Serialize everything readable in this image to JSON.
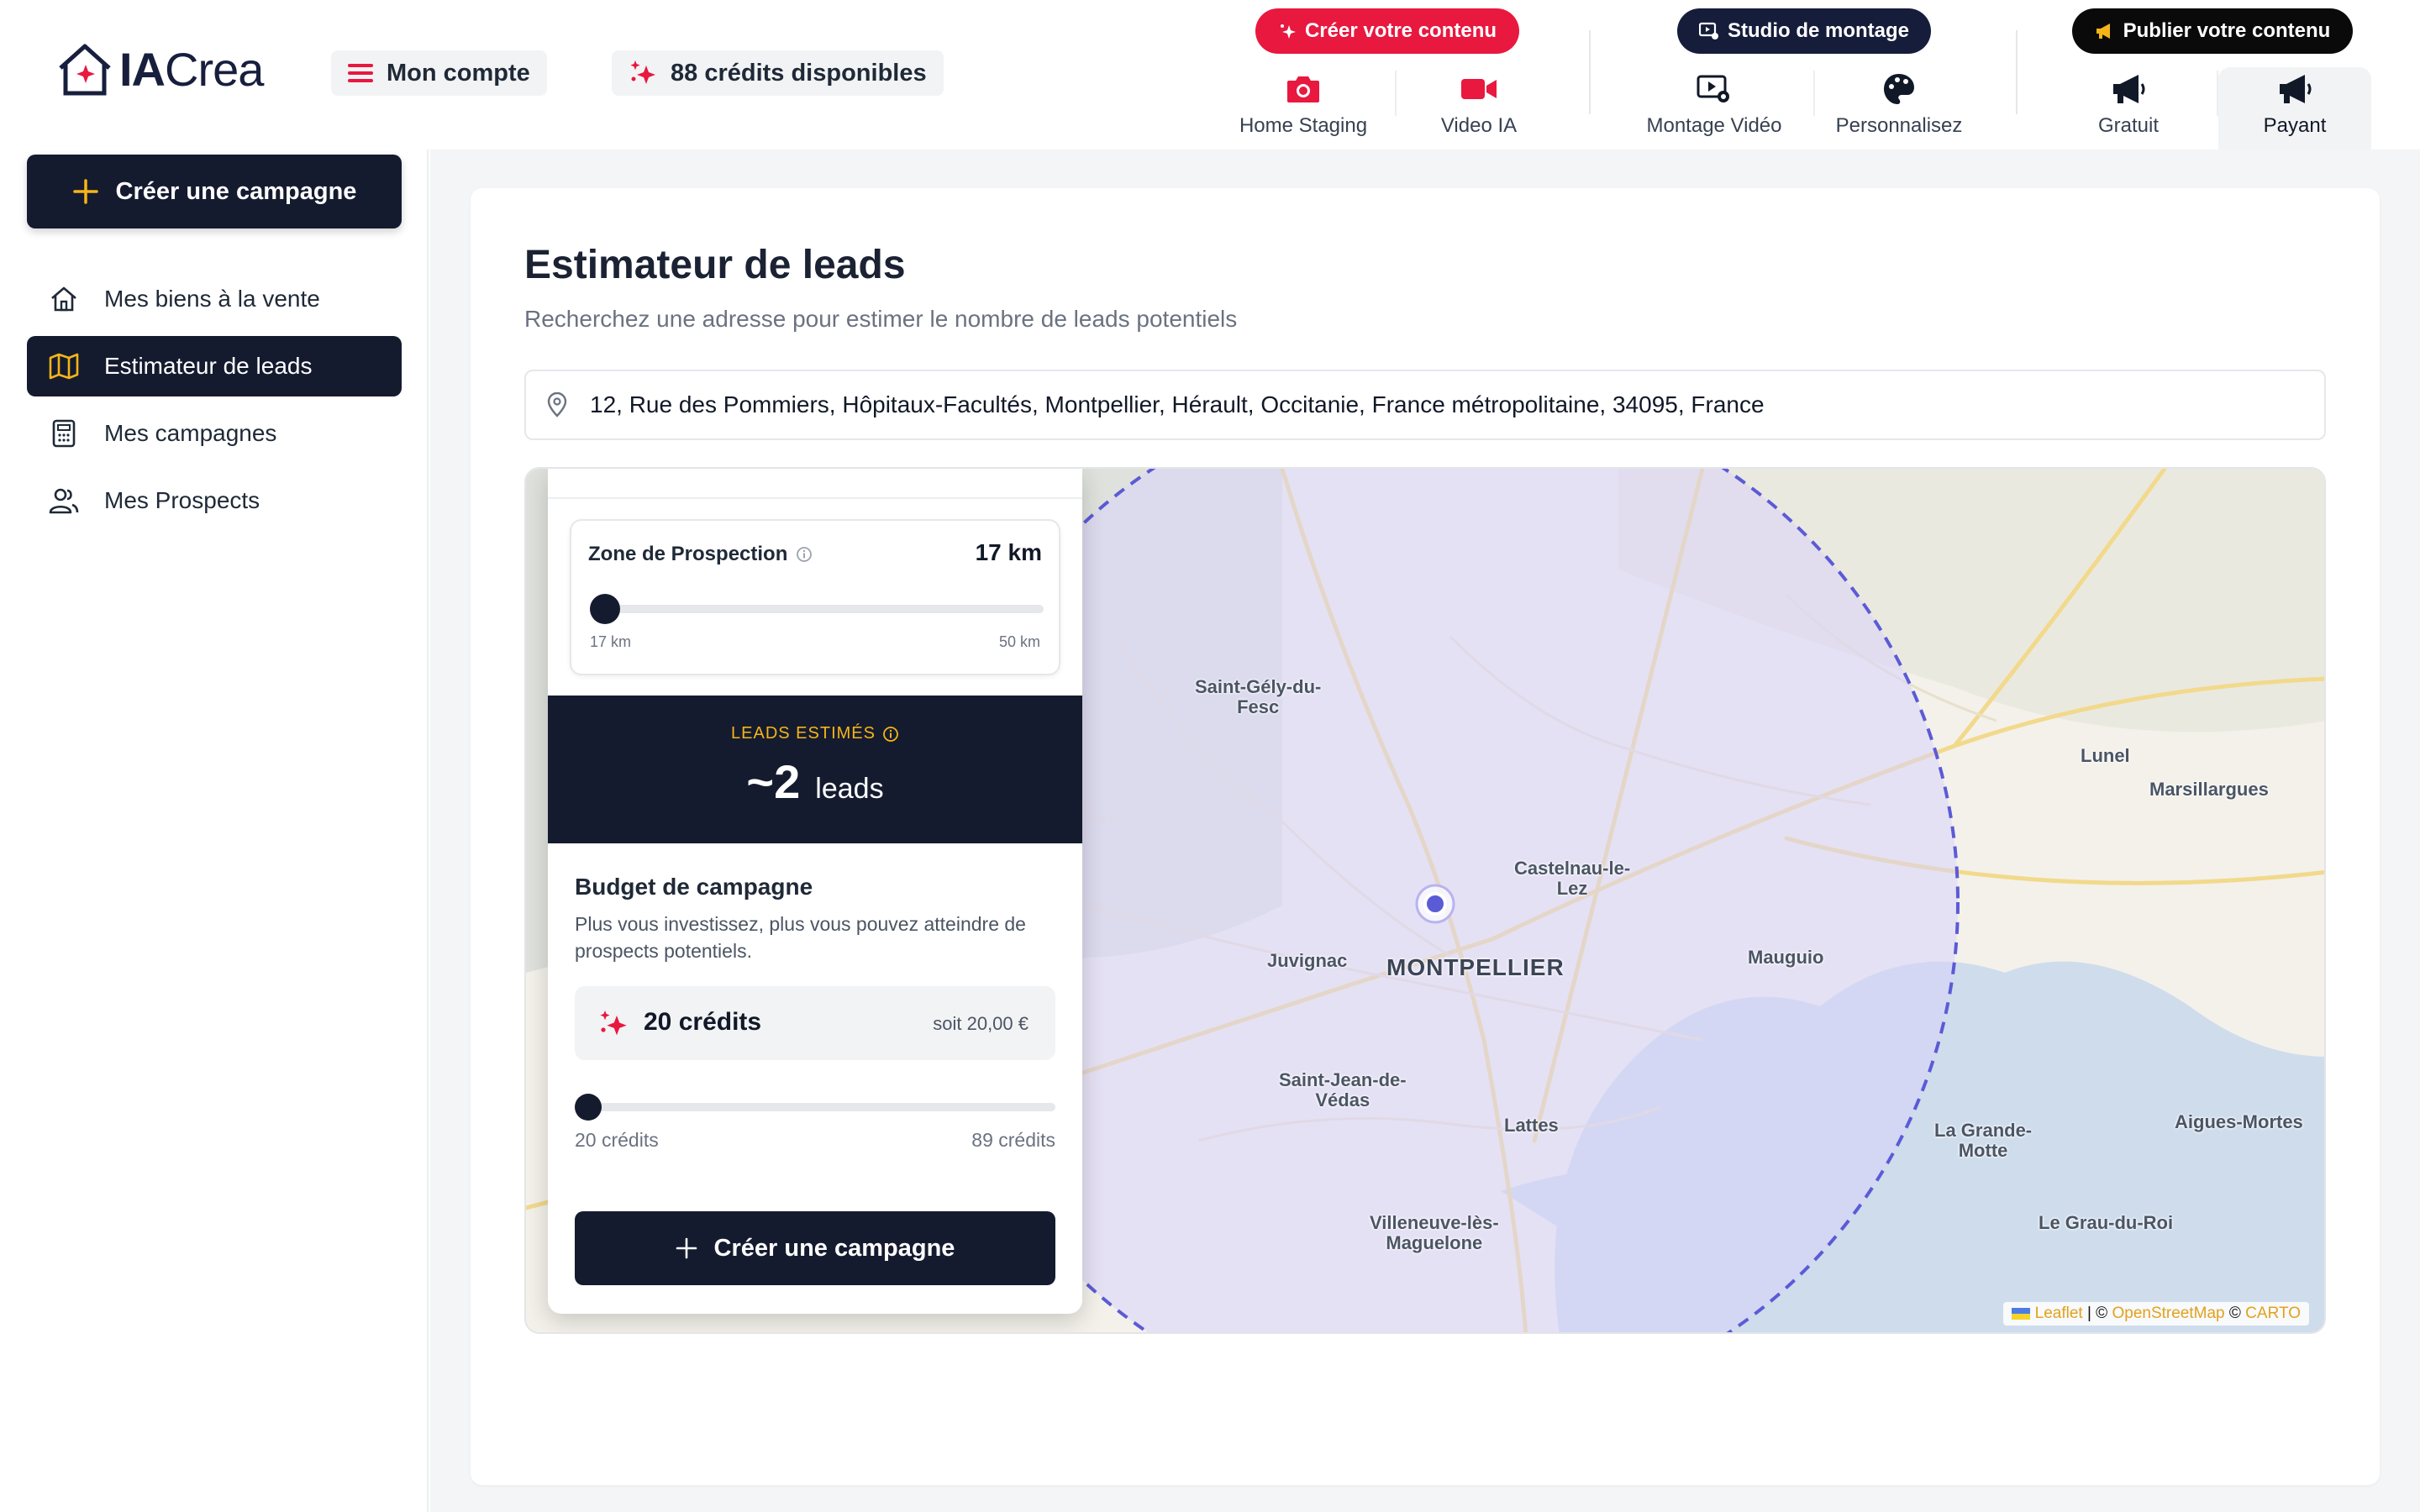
{
  "brand": {
    "name_bold": "IA",
    "name_light": "Crea"
  },
  "header": {
    "account_label": "Mon compte",
    "credits_label": "88 crédits disponibles",
    "cta_create": "Créer votre contenu",
    "cta_studio": "Studio de montage",
    "cta_publish": "Publier votre contenu",
    "nav": [
      {
        "label": "Home Staging",
        "icon": "camera-icon"
      },
      {
        "label": "Video IA",
        "icon": "video-camera-icon"
      },
      {
        "label": "Montage Vidéo",
        "icon": "video-edit-icon"
      },
      {
        "label": "Personnalisez",
        "icon": "palette-icon"
      },
      {
        "label": "Gratuit",
        "icon": "megaphone-icon"
      },
      {
        "label": "Payant",
        "icon": "megaphone-icon",
        "active": true
      }
    ]
  },
  "sidebar": {
    "create_label": "Créer une campagne",
    "items": [
      {
        "label": "Mes biens à la vente",
        "icon": "home-icon"
      },
      {
        "label": "Estimateur de leads",
        "icon": "map-icon",
        "active": true
      },
      {
        "label": "Mes campagnes",
        "icon": "calculator-icon"
      },
      {
        "label": "Mes Prospects",
        "icon": "users-icon"
      }
    ]
  },
  "page": {
    "title": "Estimateur de leads",
    "subtitle": "Recherchez une adresse pour estimer le nombre de leads potentiels",
    "address": "12, Rue des Pommiers, Hôpitaux-Facultés, Montpellier, Hérault, Occitanie, France métropolitaine, 34095, France"
  },
  "map": {
    "labels": {
      "saint_gely": "Saint-Gély-du-\nFesc",
      "castelnau": "Castelnau-le-\nLez",
      "juvignac": "Juvignac",
      "montpellier": "MONTPELLIER",
      "mauguio": "Mauguio",
      "lunel": "Lunel",
      "marsillargues": "Marsillargues",
      "saint_jean": "Saint-Jean-de-\nVédas",
      "lattes": "Lattes",
      "la_grande_motte": "La Grande-\nMotte",
      "aigues_mortes": "Aigues-Mortes",
      "villeneuve": "Villeneuve-lès-\nMaguelone",
      "grau_du_roi": "Le Grau-du-Roi"
    },
    "attribution": {
      "leaflet": "Leaflet",
      "sep1": " | © ",
      "osm": "OpenStreetMap",
      "sep2": " © ",
      "carto": "CARTO"
    },
    "radius_color": "#5b5bd6",
    "fill_color": "#d9d4fb"
  },
  "panel": {
    "zone_title": "Zone de Prospection",
    "zone_value": "17 km",
    "zone_min": "17 km",
    "zone_max": "50 km",
    "zone_fraction": 0,
    "leads_label": "LEADS ESTIMÉS",
    "leads_value": "~2",
    "leads_unit": "leads",
    "budget_title": "Budget de campagne",
    "budget_desc": "Plus vous investissez, plus vous pouvez atteindre de prospects potentiels.",
    "credits_amount": "20 crédits",
    "credits_eur": "soit 20,00 €",
    "budget_min": "20 crédits",
    "budget_max": "89 crédits",
    "budget_fraction": 0,
    "create_label": "Créer une campagne"
  },
  "colors": {
    "accent_red": "#e8183f",
    "navy": "#151b2f",
    "gold": "#f5b518"
  }
}
